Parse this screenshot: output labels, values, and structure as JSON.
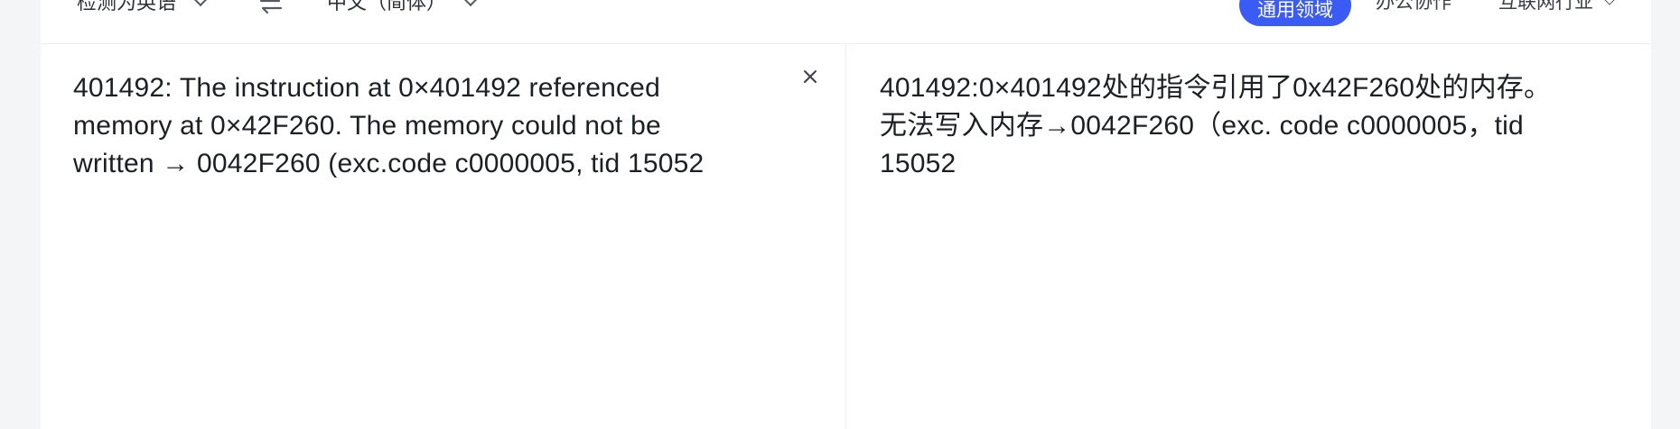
{
  "toolbar": {
    "source_language": "检测为英语",
    "target_language": "中文（简体）"
  },
  "domains": {
    "active": "通用领域",
    "office": "办公协作",
    "internet": "互联网行业"
  },
  "source": {
    "text": "401492: The instruction at 0×401492 referenced\nmemory at 0×42F260. The memory could not be\nwritten → 0042F260 (exc.code c0000005, tid 15052"
  },
  "result": {
    "text": "401492:0×401492处的指令引用了0x42F260处的内存。\n无法写入内存→0042F260（exc. code c0000005，tid\n15052"
  },
  "icons": {
    "swap": "swap-languages-icon",
    "clear": "close-icon",
    "dropdown": "chevron-down-icon"
  },
  "colors": {
    "accent": "#3a5cf4",
    "background": "#f4f5f7",
    "panel": "#ffffff",
    "text": "#1c1f24"
  }
}
